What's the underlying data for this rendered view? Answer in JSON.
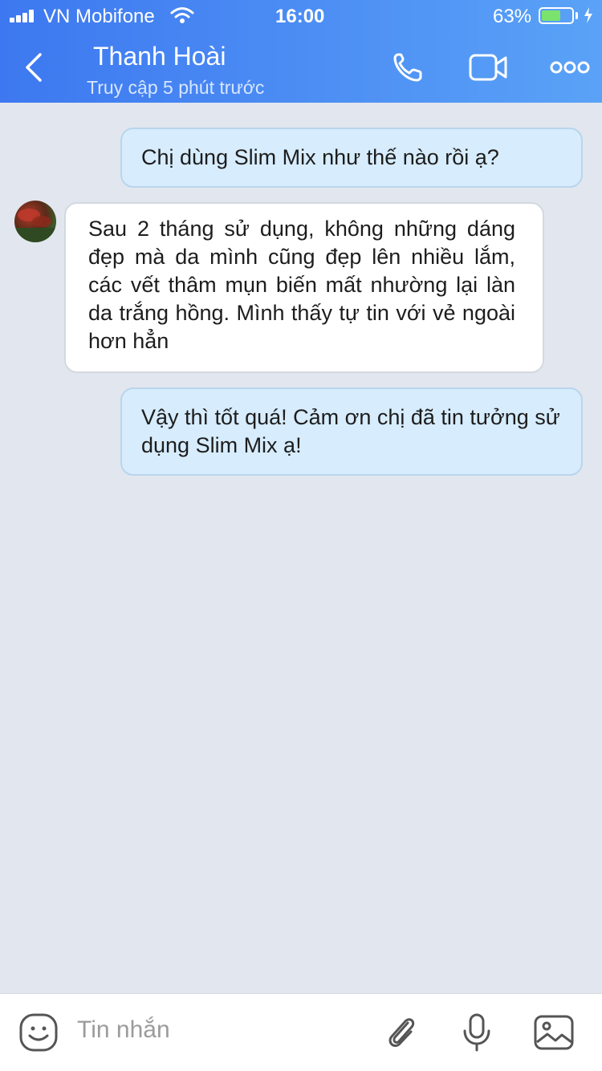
{
  "status_bar": {
    "carrier": "VN Mobifone",
    "time": "16:00",
    "battery_percent": "63%",
    "battery_level": 0.63
  },
  "header": {
    "contact_name": "Thanh Hoài",
    "last_seen": "Truy cập 5 phút trước"
  },
  "messages": [
    {
      "direction": "outgoing",
      "text": "Chị dùng Slim Mix như thế nào rồi ạ?"
    },
    {
      "direction": "incoming",
      "text": "Sau 2 tháng sử dụng, không những dáng đẹp mà da mình cũng đẹp lên nhiều lắm, các vết thâm mụn biến mất nhường lại làn da trắng hồng. Mình thấy tự tin với vẻ ngoài hơn hẳn"
    },
    {
      "direction": "outgoing",
      "text": "Vậy thì tốt quá! Cảm ơn chị đã tin tưởng sử dụng Slim Mix ạ!"
    }
  ],
  "composer": {
    "placeholder": "Tin nhắn"
  },
  "icons": {
    "back": "chevron-left-icon",
    "call": "phone-icon",
    "video": "video-camera-icon",
    "more": "more-dots-icon",
    "sticker": "sticker-face-icon",
    "attach": "paperclip-icon",
    "voice": "microphone-icon",
    "image": "image-icon"
  },
  "colors": {
    "header_start": "#3d78f0",
    "header_end": "#5aa2f7",
    "outgoing_bubble": "#d7ecfd",
    "incoming_bubble": "#ffffff",
    "chat_background": "#e2e6ee"
  }
}
